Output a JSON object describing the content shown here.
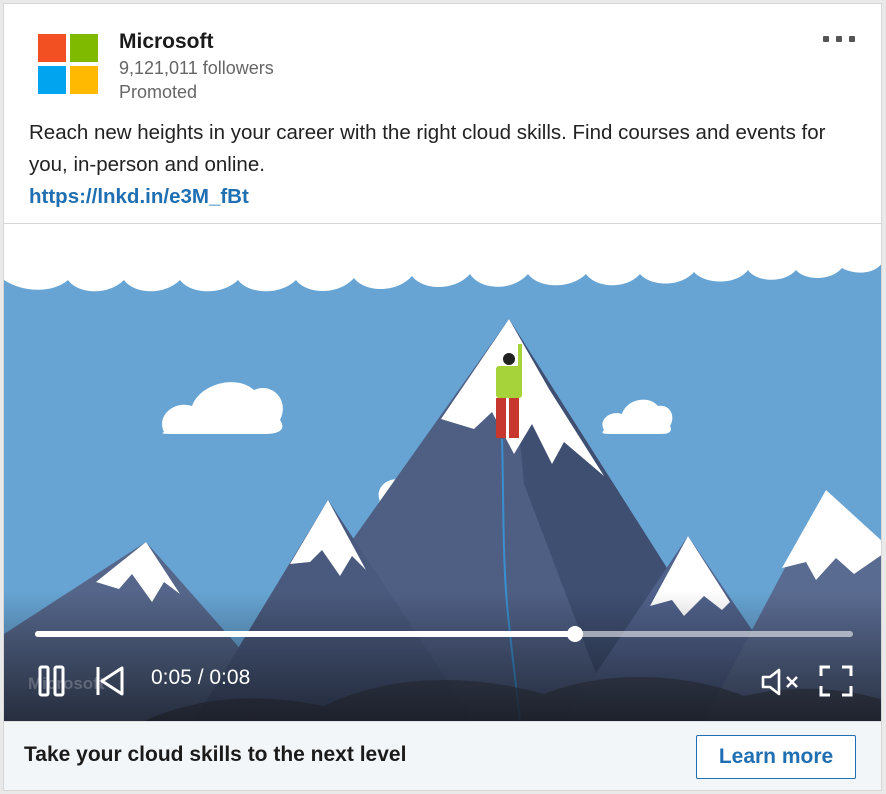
{
  "advertiser": {
    "name": "Microsoft",
    "followers": "9,121,011 followers",
    "label": "Promoted",
    "logo_colors": [
      "#f25022",
      "#7fba00",
      "#00a4ef",
      "#ffb900"
    ]
  },
  "post": {
    "text": "Reach new heights in your career with the right cloud skills. Find courses and events for you, in-person and online.",
    "link": "https://lnkd.in/e3M_fBt"
  },
  "video": {
    "current_time": "0:05",
    "duration": "0:08",
    "time_display": "0:05 / 0:08",
    "progress": 0.66,
    "muted": true,
    "watermark": "Microsoft",
    "icons": [
      "pause-icon",
      "replay-icon",
      "mute-icon",
      "fullscreen-icon"
    ]
  },
  "footer": {
    "headline": "Take your cloud skills to the next level",
    "button_label": "Learn more"
  },
  "colors": {
    "accent": "#1f6fb2",
    "sky": "#67a4d3",
    "mountain_dark": "#3d4f6e",
    "mountain_mid": "#56678b",
    "snow": "#ffffff"
  }
}
